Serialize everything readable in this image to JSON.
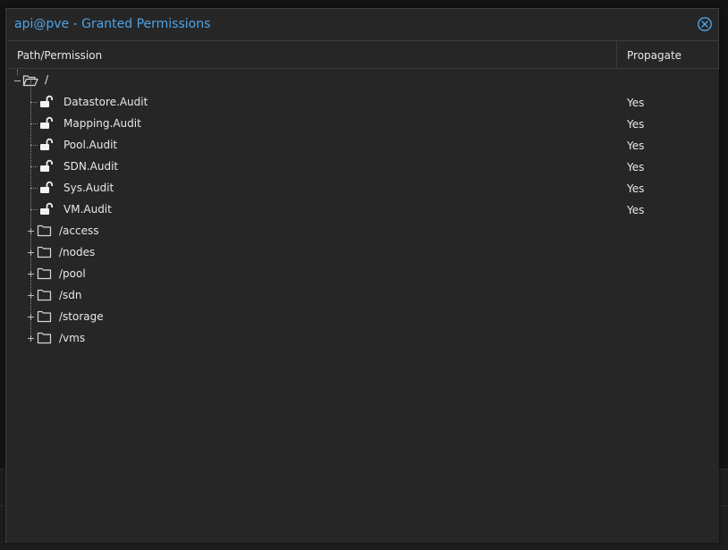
{
  "window": {
    "title": "api@pve - Granted Permissions",
    "close_icon": "close-circle-icon",
    "accent_color": "#4fa4e6"
  },
  "grid": {
    "columns": [
      {
        "label": "Path/Permission"
      },
      {
        "label": "Propagate"
      }
    ],
    "root": {
      "label": "/",
      "icon": "folder-open-icon",
      "expander": "collapse-minus-icon"
    },
    "permissions": [
      {
        "label": "Datastore.Audit",
        "propagate": "Yes",
        "icon": "unlock-icon"
      },
      {
        "label": "Mapping.Audit",
        "propagate": "Yes",
        "icon": "unlock-icon"
      },
      {
        "label": "Pool.Audit",
        "propagate": "Yes",
        "icon": "unlock-icon"
      },
      {
        "label": "SDN.Audit",
        "propagate": "Yes",
        "icon": "unlock-icon"
      },
      {
        "label": "Sys.Audit",
        "propagate": "Yes",
        "icon": "unlock-icon"
      },
      {
        "label": "VM.Audit",
        "propagate": "Yes",
        "icon": "unlock-icon"
      }
    ],
    "paths": [
      {
        "label": "/access",
        "icon": "folder-icon",
        "expander": "expand-plus-icon"
      },
      {
        "label": "/nodes",
        "icon": "folder-icon",
        "expander": "expand-plus-icon"
      },
      {
        "label": "/pool",
        "icon": "folder-icon",
        "expander": "expand-plus-icon"
      },
      {
        "label": "/sdn",
        "icon": "folder-icon",
        "expander": "expand-plus-icon"
      },
      {
        "label": "/storage",
        "icon": "folder-icon",
        "expander": "expand-plus-icon"
      },
      {
        "label": "/vms",
        "icon": "folder-icon",
        "expander": "expand-plus-icon"
      }
    ]
  }
}
